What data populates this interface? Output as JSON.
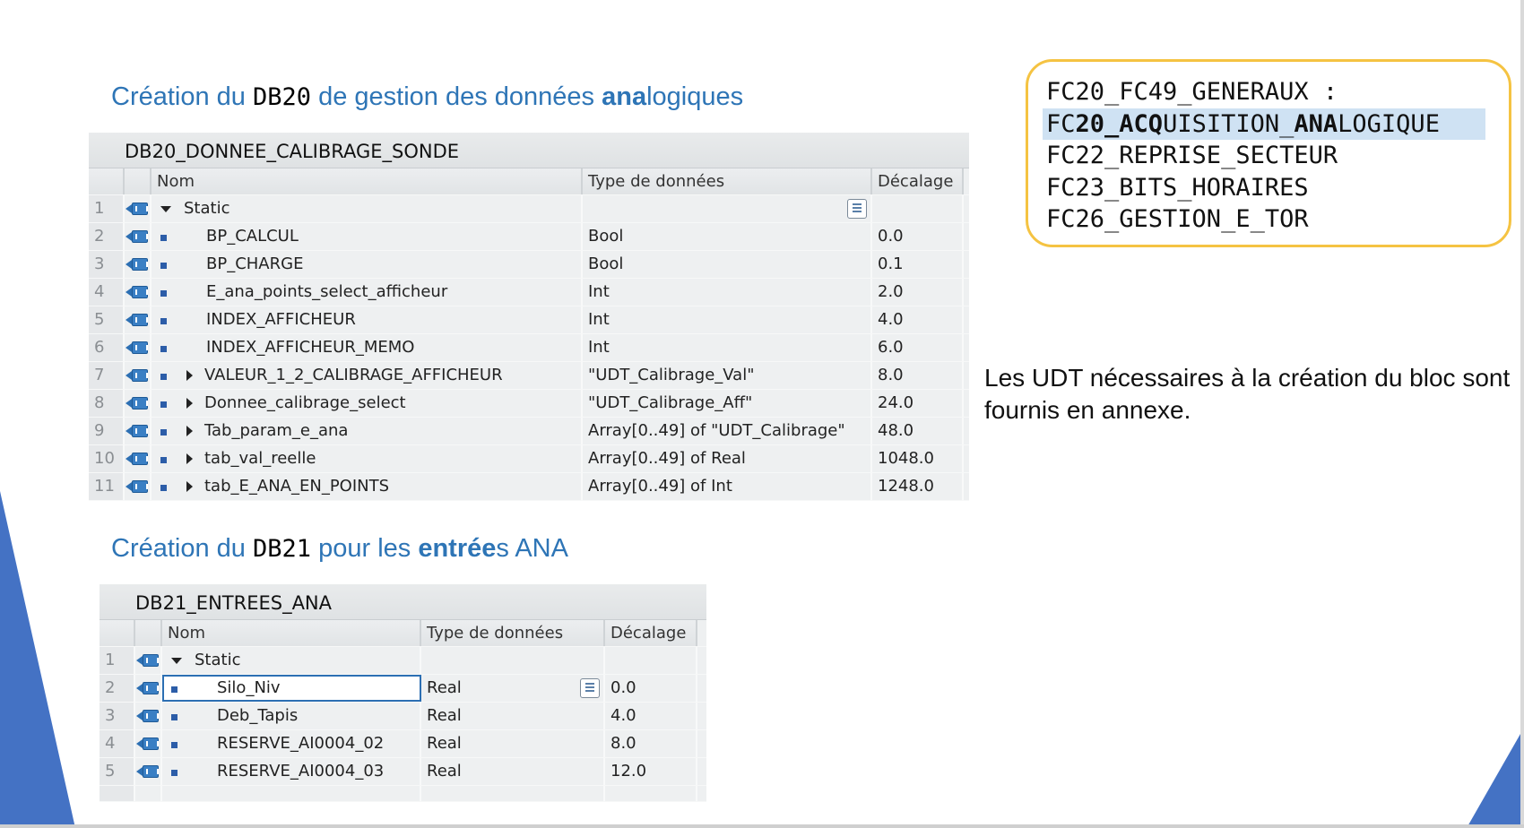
{
  "section1": {
    "title_pre": "Création du ",
    "title_db": "DB20",
    "title_mid": " de gestion des données ",
    "title_bold": "ana",
    "title_post": "logiques"
  },
  "db20": {
    "title": "DB20_DONNEE_CALIBRAGE_SONDE",
    "headers": {
      "name": "Nom",
      "type": "Type de données",
      "offset": "Décalage"
    },
    "rows": [
      {
        "num": "1",
        "name": "Static",
        "type": "",
        "offset": ""
      },
      {
        "num": "2",
        "name": "BP_CALCUL",
        "type": "Bool",
        "offset": "0.0"
      },
      {
        "num": "3",
        "name": "BP_CHARGE",
        "type": "Bool",
        "offset": "0.1"
      },
      {
        "num": "4",
        "name": "E_ana_points_select_afficheur",
        "type": "Int",
        "offset": "2.0"
      },
      {
        "num": "5",
        "name": "INDEX_AFFICHEUR",
        "type": "Int",
        "offset": "4.0"
      },
      {
        "num": "6",
        "name": "INDEX_AFFICHEUR_MEMO",
        "type": "Int",
        "offset": "6.0"
      },
      {
        "num": "7",
        "name": "VALEUR_1_2_CALIBRAGE_AFFICHEUR",
        "type": "\"UDT_Calibrage_Val\"",
        "offset": "8.0"
      },
      {
        "num": "8",
        "name": "Donnee_calibrage_select",
        "type": "\"UDT_Calibrage_Aff\"",
        "offset": "24.0"
      },
      {
        "num": "9",
        "name": "Tab_param_e_ana",
        "type": "Array[0..49] of \"UDT_Calibrage\"",
        "offset": "48.0"
      },
      {
        "num": "10",
        "name": "tab_val_reelle",
        "type": "Array[0..49] of Real",
        "offset": "1048.0"
      },
      {
        "num": "11",
        "name": "tab_E_ANA_EN_POINTS",
        "type": "Array[0..49] of Int",
        "offset": "1248.0"
      }
    ]
  },
  "section2": {
    "title_pre": "Création du ",
    "title_db": "DB21",
    "title_mid": " pour les ",
    "title_bold": "entrée",
    "title_post": "s ANA"
  },
  "db21": {
    "title": "DB21_ENTREES_ANA",
    "headers": {
      "name": "Nom",
      "type": "Type de données",
      "offset": "Décalage"
    },
    "rows": [
      {
        "num": "1",
        "name": "Static",
        "type": "",
        "offset": ""
      },
      {
        "num": "2",
        "name": "Silo_Niv",
        "type": "Real",
        "offset": "0.0"
      },
      {
        "num": "3",
        "name": "Deb_Tapis",
        "type": "Real",
        "offset": "4.0"
      },
      {
        "num": "4",
        "name": "RESERVE_AI0004_02",
        "type": "Real",
        "offset": "8.0"
      },
      {
        "num": "5",
        "name": "RESERVE_AI0004_03",
        "type": "Real",
        "offset": "12.0"
      }
    ]
  },
  "fc_list": {
    "line1": "FC20_FC49_GENERAUX :",
    "line2_a": "FC",
    "line2_b": "20_ACQ",
    "line2_c": "UISITION_",
    "line2_d": "ANA",
    "line2_e": "LOGIQUE",
    "line3": "FC22_REPRISE_SECTEUR",
    "line4": "FC23_BITS_HORAIRES",
    "line5": "FC26_GESTION_E_TOR"
  },
  "note": "Les UDT nécessaires à la création du bloc sont fournis en annexe.",
  "colors": {
    "accent": "#2e75b6",
    "fc_border": "#f5c342",
    "deco_blue": "#4472c4"
  }
}
